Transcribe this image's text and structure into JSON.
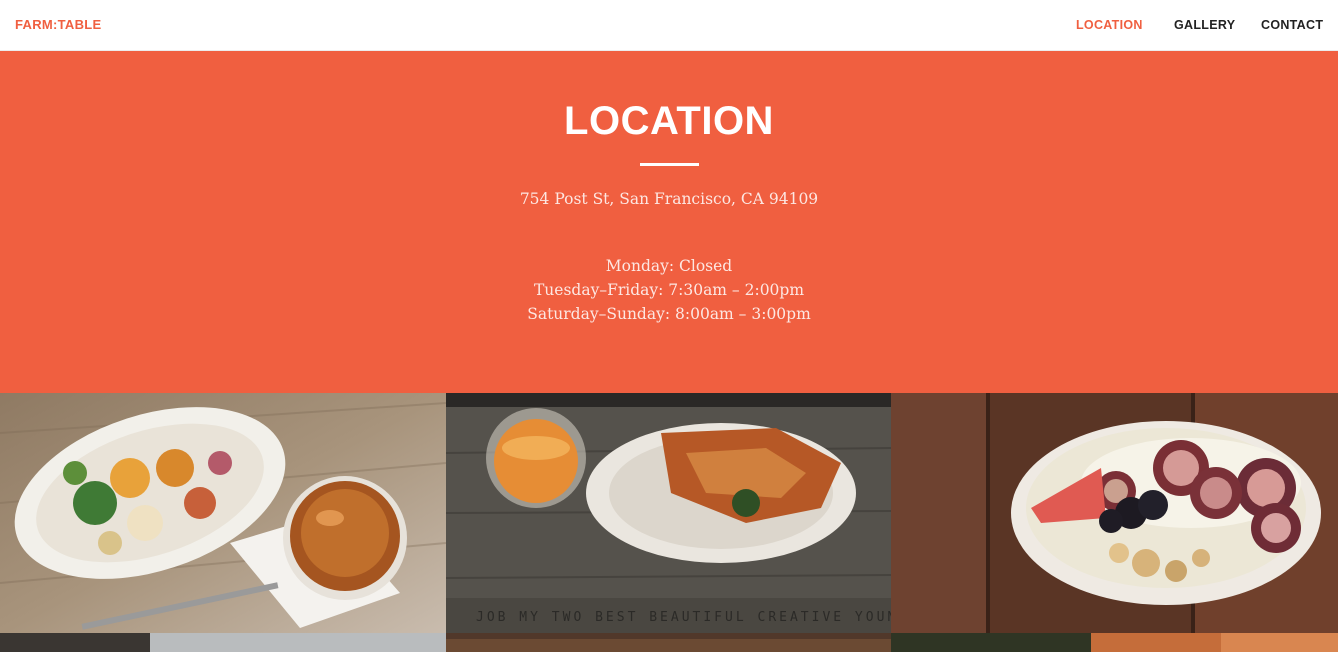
{
  "nav": {
    "brand": "FARM:TABLE",
    "items": [
      {
        "label": "LOCATION",
        "active": true
      },
      {
        "label": "GALLERY",
        "active": false
      },
      {
        "label": "CONTACT",
        "active": false
      }
    ]
  },
  "location": {
    "title": "LOCATION",
    "address": "754 Post St, San Francisco, CA 94109",
    "hours": [
      "Monday: Closed",
      "Tuesday–Friday: 7:30am – 2:00pm",
      "Saturday–Sunday: 8:00am – 3:00pm"
    ]
  },
  "colors": {
    "accent": "#f05f40",
    "nav_text": "#222222",
    "hero_text": "#ffffff"
  },
  "gallery": {
    "tiles": [
      {
        "subject": "salad-plate-and-iced-drink"
      },
      {
        "subject": "savory-pastry-and-juice-on-wooden-table"
      },
      {
        "subject": "yogurt-bowl-with-figs-and-berries"
      },
      {
        "subject": "food-photo-cropped"
      },
      {
        "subject": "food-photo-cropped"
      },
      {
        "subject": "food-photo-cropped"
      }
    ]
  }
}
